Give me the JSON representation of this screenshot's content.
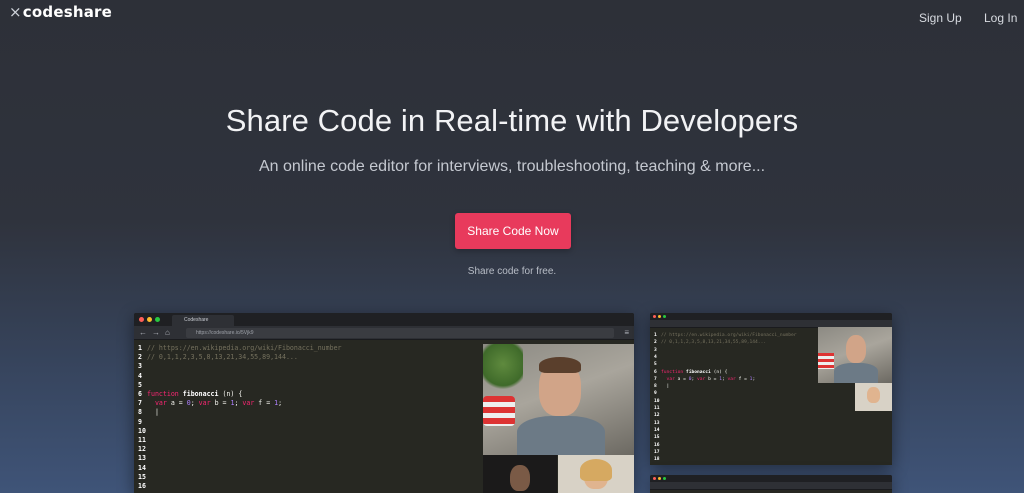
{
  "brand": {
    "logo_mark": "×",
    "logo_text": "codeshare"
  },
  "nav": {
    "signup": "Sign Up",
    "login": "Log In"
  },
  "hero": {
    "title": "Share Code in Real-time with Developers",
    "subtitle": "An online code editor for interviews, troubleshooting, teaching & more...",
    "cta": "Share Code Now",
    "note": "Share code for free."
  },
  "preview": {
    "tab_title": "Codeshare",
    "url": "https://codeshare.io/5Vjk9",
    "code_lines": [
      {
        "n": "1",
        "text": "// https://en.wikipedia.org/wiki/Fibonacci_number",
        "kind": "comment"
      },
      {
        "n": "2",
        "text": "// 0,1,1,2,3,5,8,13,21,34,55,89,144...",
        "kind": "comment"
      },
      {
        "n": "3",
        "text": "",
        "kind": "plain"
      },
      {
        "n": "4",
        "text": "",
        "kind": "plain"
      },
      {
        "n": "5",
        "text": "",
        "kind": "plain"
      },
      {
        "n": "6",
        "text": "function fibonacci (n) {",
        "kind": "func"
      },
      {
        "n": "7",
        "text": "  var a = 0; var b = 1; var f = 1;",
        "kind": "vars"
      },
      {
        "n": "8",
        "text": "  |",
        "kind": "plain"
      },
      {
        "n": "9",
        "text": "",
        "kind": "plain"
      },
      {
        "n": "10",
        "text": "",
        "kind": "plain"
      },
      {
        "n": "11",
        "text": "",
        "kind": "plain"
      },
      {
        "n": "12",
        "text": "",
        "kind": "plain"
      },
      {
        "n": "13",
        "text": "",
        "kind": "plain"
      },
      {
        "n": "14",
        "text": "",
        "kind": "plain"
      },
      {
        "n": "15",
        "text": "",
        "kind": "plain"
      },
      {
        "n": "16",
        "text": "",
        "kind": "plain"
      },
      {
        "n": "17",
        "text": "",
        "kind": "plain"
      },
      {
        "n": "18",
        "text": "",
        "kind": "plain"
      }
    ]
  },
  "colors": {
    "accent": "#e83a5c",
    "editor_bg": "#272822",
    "dot_red": "#ff5f57",
    "dot_yellow": "#febc2e",
    "dot_green": "#28c840"
  }
}
